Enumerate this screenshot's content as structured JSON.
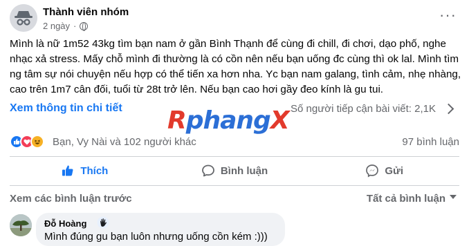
{
  "post": {
    "author": "Thành viên nhóm",
    "time": "2 ngày",
    "privacy_icon": "globe-icon",
    "more_label": "···",
    "text": "Mình là nữ 1m52 43kg tìm bạn nam ở gần Bình Thạnh để cùng đi chill, đi chơi, dạo phố, nghe nhạc xả stress. Mấy chỗ mình đi thường là có cồn nên nếu bạn uống đc cùng thì ok lal. Mình tìm ng tâm sự nói chuyện nếu hợp có thể tiến xa hơn nha. Yc bạn nam galang, tình cảm, nhẹ nhàng, cao trên 1m7 cân đối, tuổi từ 28t trở lên. Nếu bạn cao hơi gầy đeo kính là gu tui."
  },
  "insights": {
    "see_info": "Xem thông tin chi tiết",
    "reach": "Số người tiếp cận bài viết: 2,1K"
  },
  "watermark": {
    "r": "R",
    "rest": "phang",
    "x": "X"
  },
  "reactions": {
    "icons": [
      "like-icon",
      "love-icon",
      "haha-icon"
    ],
    "reactors": "Bạn, Vy Nài và 102 người khác",
    "comment_count": "97 bình luận"
  },
  "actions": {
    "like": "Thích",
    "comment": "Bình luận",
    "send": "Gửi"
  },
  "comments_bar": {
    "previous": "Xem các bình luận trước",
    "filter": "Tất cả bình luận"
  },
  "comment": {
    "name": "Đỗ Hoàng",
    "badge_icon": "wave-hand-icon",
    "text": "Mình đúng gu bạn luôn nhưng uống cồn kém :)))"
  },
  "colors": {
    "accent": "#1877f2",
    "muted": "#65676b",
    "love": "#f33e58",
    "haha": "#f7b125",
    "divider": "#ced0d4",
    "bubble": "#f0f2f5"
  }
}
